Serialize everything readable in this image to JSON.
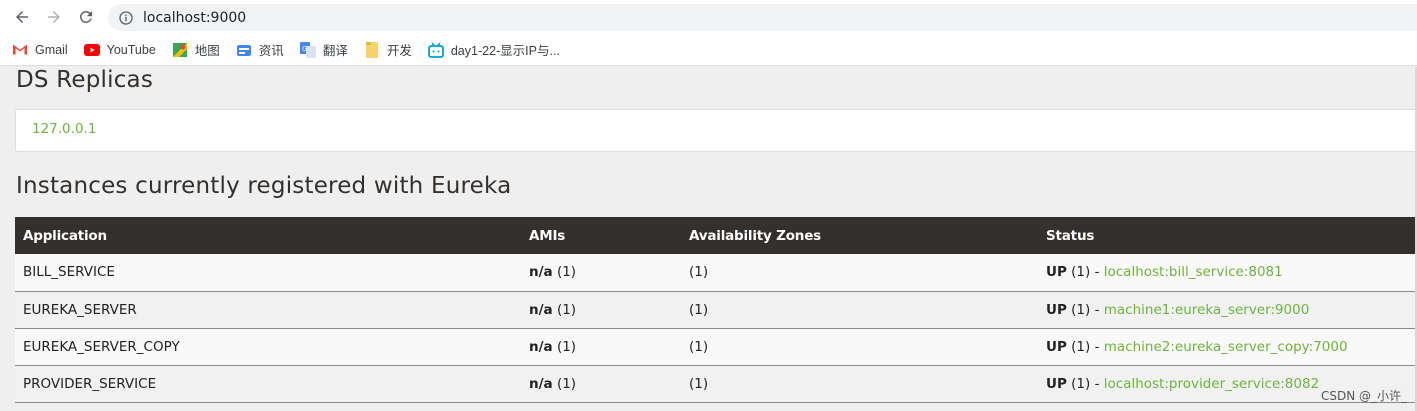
{
  "browser": {
    "url": "localhost:9000",
    "bookmarks": [
      {
        "label": "Gmail",
        "icon": "gmail-icon"
      },
      {
        "label": "YouTube",
        "icon": "youtube-icon"
      },
      {
        "label": "地图",
        "icon": "maps-icon"
      },
      {
        "label": "资讯",
        "icon": "news-icon"
      },
      {
        "label": "翻译",
        "icon": "translate-icon"
      },
      {
        "label": "开发",
        "icon": "folder-icon"
      },
      {
        "label": "day1-22-显示IP与...",
        "icon": "bilibili-icon"
      }
    ]
  },
  "replicas": {
    "title": "DS Replicas",
    "value": "127.0.0.1"
  },
  "instances": {
    "title": "Instances currently registered with Eureka",
    "headers": [
      "Application",
      "AMIs",
      "Availability Zones",
      "Status"
    ],
    "rows": [
      {
        "app": "BILL_SERVICE",
        "ami": "n/a",
        "ami_count": "(1)",
        "zones": "(1)",
        "status": "UP",
        "status_count": "(1) -",
        "instance": "localhost:bill_service:8081"
      },
      {
        "app": "EUREKA_SERVER",
        "ami": "n/a",
        "ami_count": "(1)",
        "zones": "(1)",
        "status": "UP",
        "status_count": "(1) -",
        "instance": "machine1:eureka_server:9000"
      },
      {
        "app": "EUREKA_SERVER_COPY",
        "ami": "n/a",
        "ami_count": "(1)",
        "zones": "(1)",
        "status": "UP",
        "status_count": "(1) -",
        "instance": "machine2:eureka_server_copy:7000"
      },
      {
        "app": "PROVIDER_SERVICE",
        "ami": "n/a",
        "ami_count": "(1)",
        "zones": "(1)",
        "status": "UP",
        "status_count": "(1) -",
        "instance": "localhost:provider_service:8082"
      }
    ]
  },
  "watermark": "CSDN @_小许_",
  "colors": {
    "accent": "#6db33f",
    "header_bg": "#34302d"
  }
}
